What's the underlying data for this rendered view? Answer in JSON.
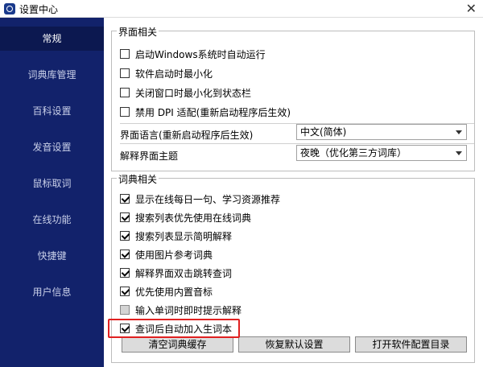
{
  "window": {
    "title": "设置中心",
    "close_glyph": "✕"
  },
  "sidebar": {
    "items": [
      {
        "label": "常规",
        "active": true
      },
      {
        "label": "词典库管理"
      },
      {
        "label": "百科设置"
      },
      {
        "label": "发音设置"
      },
      {
        "label": "鼠标取词"
      },
      {
        "label": "在线功能"
      },
      {
        "label": "快捷键"
      },
      {
        "label": "用户信息"
      }
    ]
  },
  "ui_group": {
    "legend": "界面相关",
    "checkboxes": [
      {
        "label": "启动Windows系统时自动运行",
        "checked": false
      },
      {
        "label": "软件启动时最小化",
        "checked": false
      },
      {
        "label": "关闭窗口时最小化到状态栏",
        "checked": false
      },
      {
        "label": "禁用 DPI 适配(重新启动程序后生效)",
        "checked": false
      }
    ],
    "language": {
      "label": "界面语言(重新启动程序后生效)",
      "value": "中文(简体)"
    },
    "theme": {
      "label": "解释界面主题",
      "value": "夜晚（优化第三方词库）"
    }
  },
  "dict_group": {
    "legend": "词典相关",
    "checkboxes": [
      {
        "label": "显示在线每日一句、学习资源推荐",
        "checked": true
      },
      {
        "label": "搜索列表优先使用在线词典",
        "checked": true
      },
      {
        "label": "搜索列表显示简明解释",
        "checked": true
      },
      {
        "label": "使用图片参考词典",
        "checked": true
      },
      {
        "label": "解释界面双击跳转查词",
        "checked": true
      },
      {
        "label": "优先使用内置音标",
        "checked": true
      },
      {
        "label": "输入单词时即时提示解释",
        "checked": false,
        "disabled": true
      },
      {
        "label": "查词后自动加入生词本",
        "checked": true
      }
    ]
  },
  "buttons": {
    "clear_cache": "清空词典缓存",
    "restore_default": "恢复默认设置",
    "open_config": "打开软件配置目录"
  },
  "colors": {
    "sidebar_bg": "#12226b",
    "active_bg": "#0c1850",
    "highlight": "#e02020"
  }
}
